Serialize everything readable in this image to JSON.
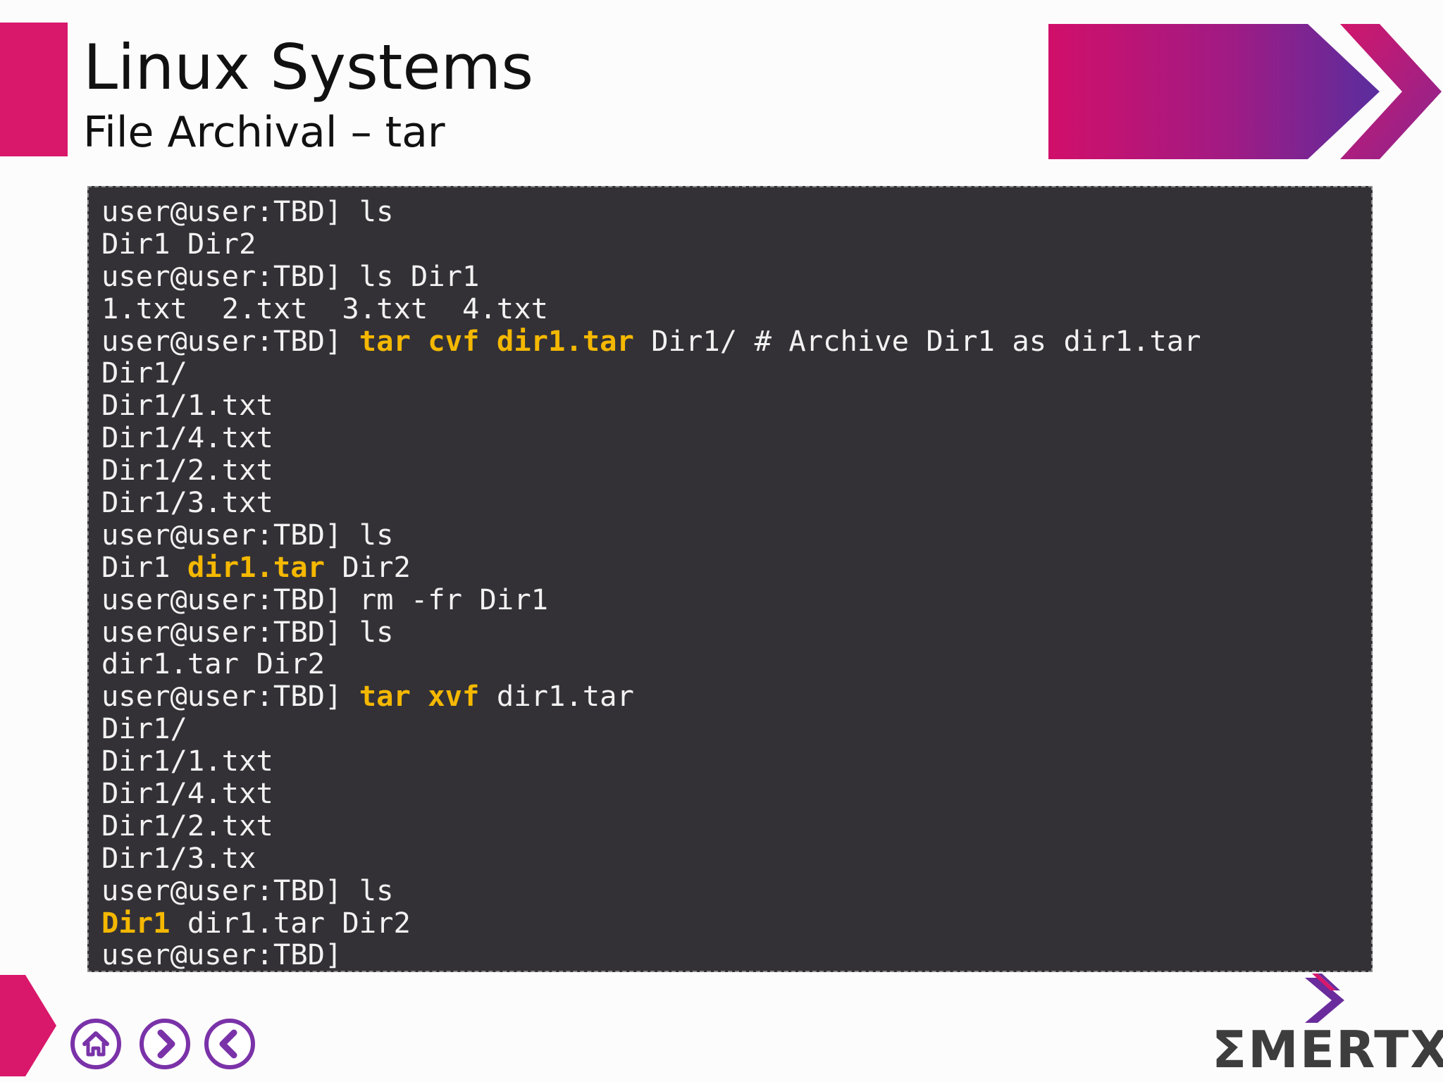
{
  "header": {
    "title": "Linux Systems",
    "subtitle": "File Archival – tar"
  },
  "terminal": {
    "lines": [
      [
        {
          "t": "user@user:TBD] ls"
        }
      ],
      [
        {
          "t": "Dir1 Dir2"
        }
      ],
      [
        {
          "t": "user@user:TBD] ls Dir1"
        }
      ],
      [
        {
          "t": "1.txt  2.txt  3.txt  4.txt"
        }
      ],
      [
        {
          "t": "user@user:TBD] "
        },
        {
          "t": "tar cvf dir1.tar",
          "hl": true
        },
        {
          "t": " Dir1/ # Archive Dir1 as dir1.tar"
        }
      ],
      [
        {
          "t": "Dir1/"
        }
      ],
      [
        {
          "t": "Dir1/1.txt"
        }
      ],
      [
        {
          "t": "Dir1/4.txt"
        }
      ],
      [
        {
          "t": "Dir1/2.txt"
        }
      ],
      [
        {
          "t": "Dir1/3.txt"
        }
      ],
      [
        {
          "t": "user@user:TBD] ls"
        }
      ],
      [
        {
          "t": "Dir1 "
        },
        {
          "t": "dir1.tar",
          "hl": true
        },
        {
          "t": " Dir2"
        }
      ],
      [
        {
          "t": "user@user:TBD] rm -fr Dir1"
        }
      ],
      [
        {
          "t": "user@user:TBD] ls"
        }
      ],
      [
        {
          "t": "dir1.tar Dir2"
        }
      ],
      [
        {
          "t": "user@user:TBD] "
        },
        {
          "t": "tar xvf",
          "hl": true
        },
        {
          "t": " dir1.tar"
        }
      ],
      [
        {
          "t": "Dir1/"
        }
      ],
      [
        {
          "t": "Dir1/1.txt"
        }
      ],
      [
        {
          "t": "Dir1/4.txt"
        }
      ],
      [
        {
          "t": "Dir1/2.txt"
        }
      ],
      [
        {
          "t": "Dir1/3.tx"
        }
      ],
      [
        {
          "t": "user@user:TBD] ls"
        }
      ],
      [
        {
          "t": "Dir1",
          "hl": true
        },
        {
          "t": " dir1.tar Dir2"
        }
      ],
      [
        {
          "t": "user@user:TBD]"
        }
      ]
    ]
  },
  "nav": {
    "home_icon": "home-icon",
    "next_icon": "chevron-right-icon",
    "prev_icon": "chevron-left-icon"
  },
  "logo": {
    "text": "ΣMERTXE"
  },
  "colors": {
    "accent_pink": "#d9176b",
    "accent_purple": "#6a2c9c",
    "terminal_bg": "#333136",
    "terminal_text": "#f2f2f2",
    "highlight": "#f5b800"
  }
}
